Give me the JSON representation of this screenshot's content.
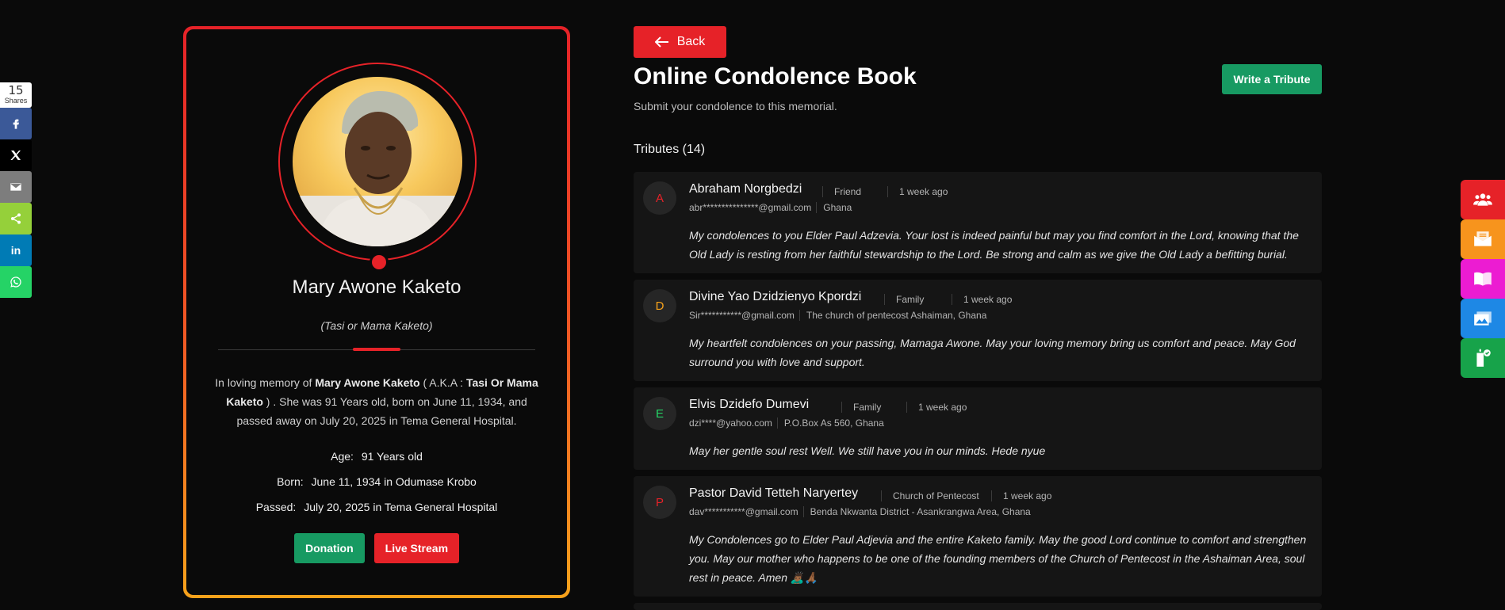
{
  "share": {
    "count": "15",
    "label": "Shares",
    "buttons": [
      {
        "name": "facebook",
        "icon": "facebook-icon",
        "color": "#3b5998"
      },
      {
        "name": "x",
        "icon": "x-icon",
        "color": "#000000"
      },
      {
        "name": "email",
        "icon": "email-icon",
        "color": "#7d7d7d"
      },
      {
        "name": "share",
        "icon": "share-icon",
        "color": "#95d03a"
      },
      {
        "name": "linkedin",
        "icon": "linkedin-icon",
        "color": "#007bb5"
      },
      {
        "name": "whatsapp",
        "icon": "whatsapp-icon",
        "color": "#25d366"
      }
    ]
  },
  "profile": {
    "name": "Mary Awone Kaketo",
    "alias": "(Tasi or Mama Kaketo)",
    "bio": {
      "p1": "In loving memory of ",
      "name": "Mary Awone Kaketo",
      "p2": " ( A.K.A : ",
      "aka": "Tasi Or Mama Kaketo",
      "p3": " ) . She was 91 Years old, born on June 11, 1934, and passed away on July 20, 2025 in Tema General Hospital."
    },
    "age_label": "Age:",
    "age_value": "91 Years old",
    "born_label": "Born:",
    "born_value": "June 11, 1934 in Odumase Krobo",
    "passed_label": "Passed:",
    "passed_value": "July 20, 2025 in Tema General Hospital",
    "donation_label": "Donation",
    "livestream_label": "Live Stream"
  },
  "header": {
    "back_label": "Back",
    "title": "Online Condolence Book",
    "subtitle": "Submit your condolence to this memorial.",
    "write_label": "Write a Tribute",
    "tributes_heading": "Tributes (14)"
  },
  "tributes": [
    {
      "initial": "A",
      "initial_color": "#e62228",
      "name": "Abraham Norgbedzi",
      "relation": "Friend",
      "time": "1 week ago",
      "email": "abr***************@gmail.com",
      "location": "Ghana",
      "message": "My condolences to you Elder Paul Adzevia. Your lost is indeed painful but may you find comfort in the Lord, knowing that the Old Lady is resting from her faithful stewardship to the Lord. Be strong and calm as we give the Old Lady a befitting burial."
    },
    {
      "initial": "D",
      "initial_color": "#f7a21b",
      "name": "Divine Yao Dzidzienyo Kpordzi",
      "relation": "Family",
      "time": "1 week ago",
      "email": "Sir***********@gmail.com",
      "location": "The church of pentecost Ashaiman, Ghana",
      "message": "My heartfelt condolences on your passing, Mamaga Awone. May your loving memory bring us comfort and peace. May God surround you with love and support."
    },
    {
      "initial": "E",
      "initial_color": "#25d366",
      "name": "Elvis Dzidefo Dumevi",
      "relation": "Family",
      "time": "1 week ago",
      "email": "dzi****@yahoo.com",
      "location": "P.O.Box As 560, Ghana",
      "message": "May her gentle soul rest Well. We still have you in our minds. Hede nyue"
    },
    {
      "initial": "P",
      "initial_color": "#e62228",
      "name": "Pastor David Tetteh Naryertey",
      "relation": "Church of Pentecost",
      "time": "1 week ago",
      "email": "dav***********@gmail.com",
      "location": "Benda Nkwanta District - Asankrangwa Area, Ghana",
      "message": "My Condolences go to Elder Paul Adjevia and the entire Kaketo family. May the good Lord continue to comfort and strengthen you. May our mother who happens to be one of the founding members of the Church of Pentecost in the Ashaiman Area, soul rest in peace. Amen 🙇🏾‍♂️🙏🏾"
    }
  ],
  "float_menu": [
    {
      "icon": "people-group-icon",
      "color": "#e62228"
    },
    {
      "icon": "envelope-icon",
      "color": "#f7941d"
    },
    {
      "icon": "book-icon",
      "color": "#ec1cd2"
    },
    {
      "icon": "photos-icon",
      "color": "#1e88e5"
    },
    {
      "icon": "candle-icon",
      "color": "#17a34a"
    }
  ]
}
